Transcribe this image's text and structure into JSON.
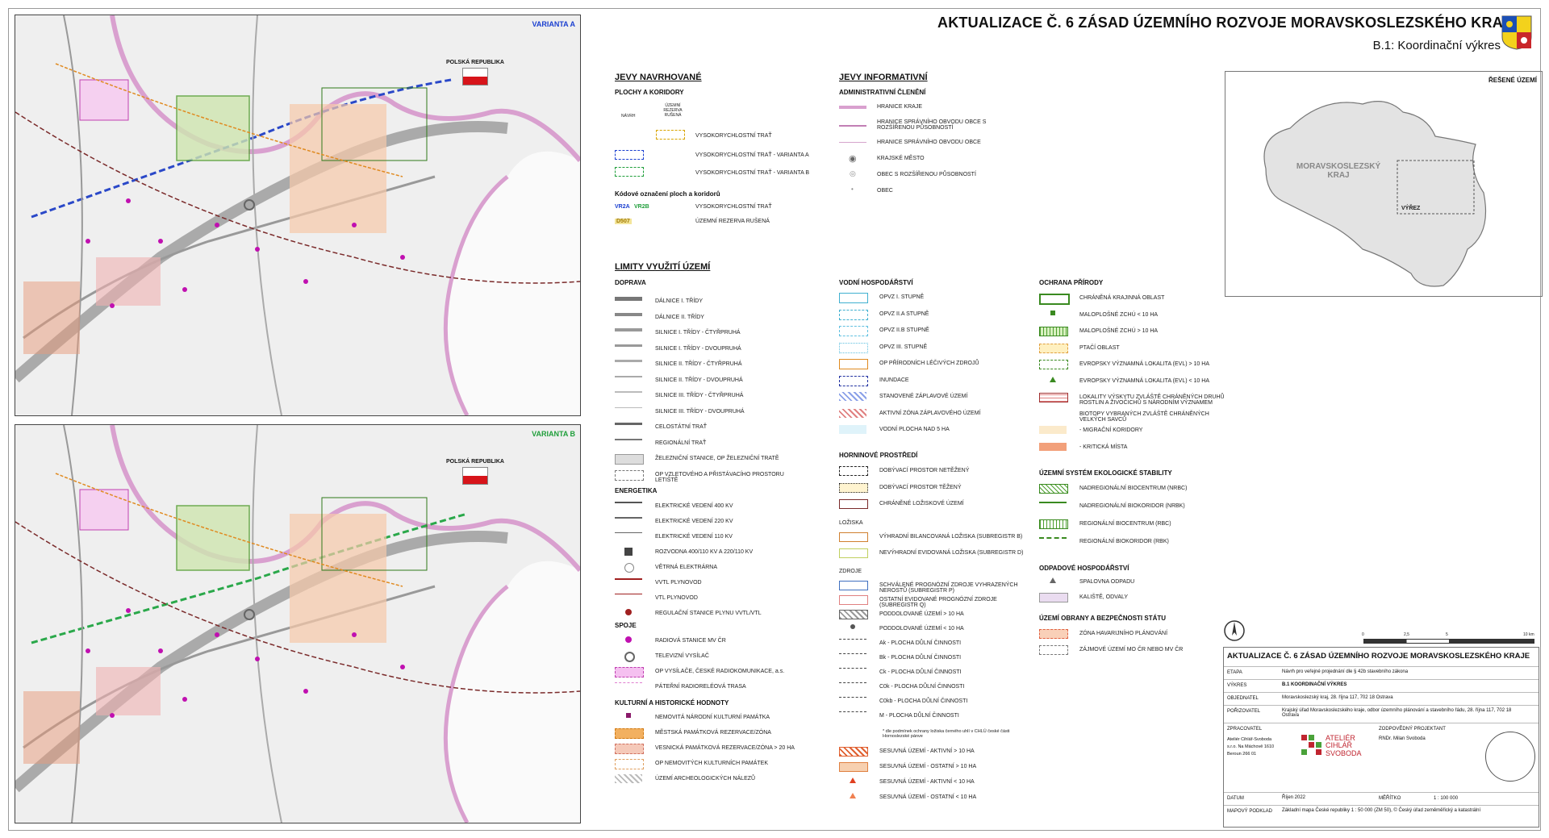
{
  "header": {
    "title": "AKTUALIZACE Č. 6 ZÁSAD ÚZEMNÍHO ROZVOJE MORAVSKOSLEZSKÉHO KRAJE",
    "subtitle": "B.1: Koordinační výkres"
  },
  "maps": {
    "a": {
      "variant": "VARIANTA A",
      "country": "POLSKÁ REPUBLIKA",
      "variant_color": "#1a3fd0"
    },
    "b": {
      "variant": "VARIANTA B",
      "country": "POLSKÁ REPUBLIKA",
      "variant_color": "#1f9e3a"
    }
  },
  "legend_proposed": {
    "title": "JEVY NAVRHOVANÉ",
    "subtitle": "PLOCHY A KORIDORY",
    "col_navrh": "NÁVRH",
    "col_rezerva": "ÚZEMNÍ REZERVA RUŠENÁ",
    "items": [
      "VYSOKORYCHLOSTNÍ TRAŤ",
      "VYSOKORYCHLOSTNÍ TRAŤ - VARIANTA A",
      "VYSOKORYCHLOSTNÍ TRAŤ - VARIANTA B"
    ],
    "codes_title": "Kódové označení ploch a koridorů",
    "code1": "VR2A",
    "code1b": "VR2B",
    "code1_label": "VYSOKORYCHLOSTNÍ TRAŤ",
    "code2": "D507",
    "code2_label": "ÚZEMNÍ REZERVA RUŠENÁ"
  },
  "legend_info": {
    "title": "JEVY INFORMATIVNÍ",
    "subtitle": "ADMINISTRATIVNÍ ČLENĚNÍ",
    "items": [
      "HRANICE KRAJE",
      "HRANICE SPRÁVNÍHO OBVODU OBCE S ROZŠÍŘENOU PŮSOBNOSTÍ",
      "HRANICE SPRÁVNÍHO OBVODU OBCE",
      "KRAJSKÉ MĚSTO",
      "OBEC S ROZŠÍŘENOU PŮSOBNOSTÍ",
      "OBEC"
    ]
  },
  "limits": {
    "title": "LIMITY VYUŽITÍ ÚZEMÍ",
    "doprava_title": "DOPRAVA",
    "doprava": [
      "DÁLNICE I. TŘÍDY",
      "DÁLNICE II. TŘÍDY",
      "SILNICE I. TŘÍDY - ČTYŘPRUHÁ",
      "SILNICE I. TŘÍDY - DVOUPRUHÁ",
      "SILNICE II. TŘÍDY - ČTYŘPRUHÁ",
      "SILNICE II. TŘÍDY - DVOUPRUHÁ",
      "SILNICE III. TŘÍDY - ČTYŘPRUHÁ",
      "SILNICE III. TŘÍDY - DVOUPRUHÁ",
      "CELOSTÁTNÍ TRAŤ",
      "REGIONÁLNÍ TRAŤ",
      "ŽELEZNIČNÍ STANICE, OP ŽELEZNIČNÍ TRATĚ",
      "OP VZLETOVÉHO A PŘISTÁVACÍHO PROSTORU LETIŠTĚ"
    ],
    "energetika_title": "ENERGETIKA",
    "energetika": [
      "ELEKTRICKÉ VEDENÍ 400 KV",
      "ELEKTRICKÉ VEDENÍ 220 KV",
      "ELEKTRICKÉ VEDENÍ 110 KV",
      "ROZVODNA 400/110 KV A 220/110 KV",
      "VĚTRNÁ ELEKTRÁRNA",
      "VVTL PLYNOVOD",
      "VTL PLYNOVOD",
      "REGULAČNÍ STANICE PLYNU VVTL/VTL"
    ],
    "spoje_title": "SPOJE",
    "spoje": [
      "RADIOVÁ STANICE MV ČR",
      "TELEVIZNÍ VYSÍLAČ",
      "OP VYSÍLAČE, ČESKÉ RADIOKOMUNIKACE, a.s.",
      "PÁTEŘNÍ RADIORELÉOVÁ TRASA"
    ],
    "kultura_title": "KULTURNÍ A HISTORICKÉ HODNOTY",
    "kultura": [
      "NEMOVITÁ NÁRODNÍ KULTURNÍ PAMÁTKA",
      "MĚSTSKÁ PAMÁTKOVÁ REZERVACE/ZÓNA",
      "VESNICKÁ PAMÁTKOVÁ REZERVACE/ZÓNA > 20 HA",
      "OP NEMOVITÝCH KULTURNÍCH PAMÁTEK",
      "ÚZEMÍ ARCHEOLOGICKÝCH NÁLEZŮ"
    ]
  },
  "voda": {
    "title": "VODNÍ HOSPODÁŘSTVÍ",
    "items": [
      "OPVZ I. STUPNĚ",
      "OPVZ II.A STUPNĚ",
      "OPVZ II.B STUPNĚ",
      "OPVZ III. STUPNĚ",
      "OP PŘÍRODNÍCH LÉČIVÝCH ZDROJŮ",
      "INUNDACE",
      "STANOVENÉ ZÁPLAVOVÉ ÚZEMÍ",
      "AKTIVNÍ ZÓNA ZÁPLAVOVÉHO ÚZEMÍ",
      "VODNÍ PLOCHA NAD 5 HA"
    ]
  },
  "horniny": {
    "title": "HORNINOVÉ PROSTŘEDÍ",
    "items": [
      "DOBÝVACÍ PROSTOR NETĚŽENÝ",
      "DOBÝVACÍ PROSTOR TĚŽENÝ",
      "CHRÁNĚNÉ LOŽISKOVÉ ÚZEMÍ"
    ],
    "loziska_title": "LOŽISKA",
    "loziska": [
      "VÝHRADNÍ BILANCOVANÁ LOŽISKA (SUBREGISTR B)",
      "NEVÝHRADNÍ EVIDOVANÁ LOŽISKA (SUBREGISTR D)"
    ],
    "zdroje_title": "ZDROJE",
    "zdroje": [
      "SCHVÁLENÉ PROGNÓZNÍ ZDROJE VYHRAZENÝCH NEROSTŮ (SUBREGISTR P)",
      "OSTATNÍ EVIDOVANÉ PROGNÓZNÍ ZDROJE (SUBREGISTR Q)",
      "PODDOLOVANÉ ÚZEMÍ > 10 HA",
      "PODDOLOVANÉ ÚZEMÍ < 10 HA",
      "Ak - PLOCHA DŮLNÍ ČINNOSTI",
      "Bk - PLOCHA DŮLNÍ ČINNOSTI",
      "Ck - PLOCHA DŮLNÍ ČINNOSTI",
      "C0k - PLOCHA DŮLNÍ ČINNOSTI",
      "C0kb - PLOCHA DŮLNÍ ČINNOSTI",
      "M - PLOCHA DŮLNÍ ČINNOSTI"
    ],
    "footnote": "* dle podmínek ochrany ložiska černého uhlí v CHLÚ české části Hornoslezské pánve",
    "sesuvy": [
      "SESUVNÁ ÚZEMÍ - AKTIVNÍ > 10 HA",
      "SESUVNÁ ÚZEMÍ - OSTATNÍ > 10 HA",
      "SESUVNÁ ÚZEMÍ - AKTIVNÍ < 10 HA",
      "SESUVNÁ ÚZEMÍ - OSTATNÍ < 10 HA"
    ]
  },
  "priroda": {
    "title": "OCHRANA PŘÍRODY",
    "items": [
      "CHRÁNĚNÁ KRAJINNÁ OBLAST",
      "MALOPLOŠNÉ ZCHÚ < 10 HA",
      "MALOPLOŠNÉ ZCHÚ > 10 HA",
      "PTAČÍ OBLAST",
      "EVROPSKY VÝZNAMNÁ LOKALITA (EVL) > 10 HA",
      "EVROPSKY VÝZNAMNÁ LOKALITA (EVL) < 10 HA",
      "LOKALITY VÝSKYTU ZVLÁŠTĚ CHRÁNĚNÝCH DRUHŮ ROSTLIN A ŽIVOČICHŮ S NÁRODNÍM VÝZNAMEM",
      "BIOTOPY VYBRANÝCH ZVLÁŠTĚ CHRÁNĚNÝCH VELKÝCH SAVCŮ",
      "- MIGRAČNÍ KORIDORY",
      "- KRITICKÁ MÍSTA"
    ],
    "uses_title": "ÚZEMNÍ SYSTÉM EKOLOGICKÉ STABILITY",
    "uses": [
      "NADREGIONÁLNÍ BIOCENTRUM (NRBC)",
      "NADREGIONÁLNÍ BIOKORIDOR (NRBK)",
      "REGIONÁLNÍ BIOCENTRUM (RBC)",
      "REGIONÁLNÍ BIOKORIDOR (RBK)"
    ],
    "odpad_title": "ODPADOVÉ HOSPODÁŘSTVÍ",
    "odpad": [
      "SPALOVNA ODPADU",
      "KALIŠTĚ, ODVALY"
    ],
    "obrana_title": "ÚZEMÍ OBRANY A BEZPEČNOSTI STÁTU",
    "obrana": [
      "ZÓNA HAVARIJNÍHO PLÁNOVÁNÍ",
      "ZÁJMOVÉ ÚZEMÍ MO ČR NEBO MV ČR"
    ]
  },
  "inset": {
    "title": "ŘEŠENÉ ÚZEMÍ",
    "region": "MORAVSKOSLEZSKÝ KRAJ",
    "cutout": "VÝŘEZ"
  },
  "scale": {
    "ticks": [
      "0",
      "2,5",
      "5",
      "10 km"
    ]
  },
  "title_block": {
    "title": "AKTUALIZACE Č. 6 ZÁSAD ÚZEMNÍHO ROZVOJE MORAVSKOSLEZSKÉHO KRAJE",
    "rows": [
      {
        "k": "ETAPA",
        "v": "Návrh pro veřejné projednání dle § 42b stavebního zákona"
      },
      {
        "k": "VÝKRES",
        "v": "B.1 KOORDINAČNÍ VÝKRES"
      },
      {
        "k": "OBJEDNATEL",
        "v": "Moravskoslezský kraj, 28. října 117, 702 18 Ostrava"
      },
      {
        "k": "POŘIZOVATEL",
        "v": "Krajský úřad Moravskoslezského kraje, odbor územního plánování a stavebního řádu, 28. října 117, 702 18 Ostrava"
      }
    ],
    "zpracovatel_k": "ZPRACOVATEL",
    "zpracovatel_v": "Ateliér Cihlář-Svoboda s.r.o. Na Máchově 1610 Beroun 266 01",
    "logo_text": "ATELIÉR CIHLÁŘ SVOBODA",
    "projektant_k": "ZODPOVĚDNÝ PROJEKTANT",
    "projektant_v": "RNDr. Milan Svoboda",
    "datum_k": "DATUM",
    "datum_v": "Říjen 2022",
    "meritko_k": "MĚŘÍTKO",
    "meritko_v": "1 : 100 000",
    "podklad_k": "MAPOVÝ PODKLAD",
    "podklad_v": "Základní mapa České republiky 1 : 50 000 (ZM 50), © Český úřad zeměměřický a katastrální"
  }
}
